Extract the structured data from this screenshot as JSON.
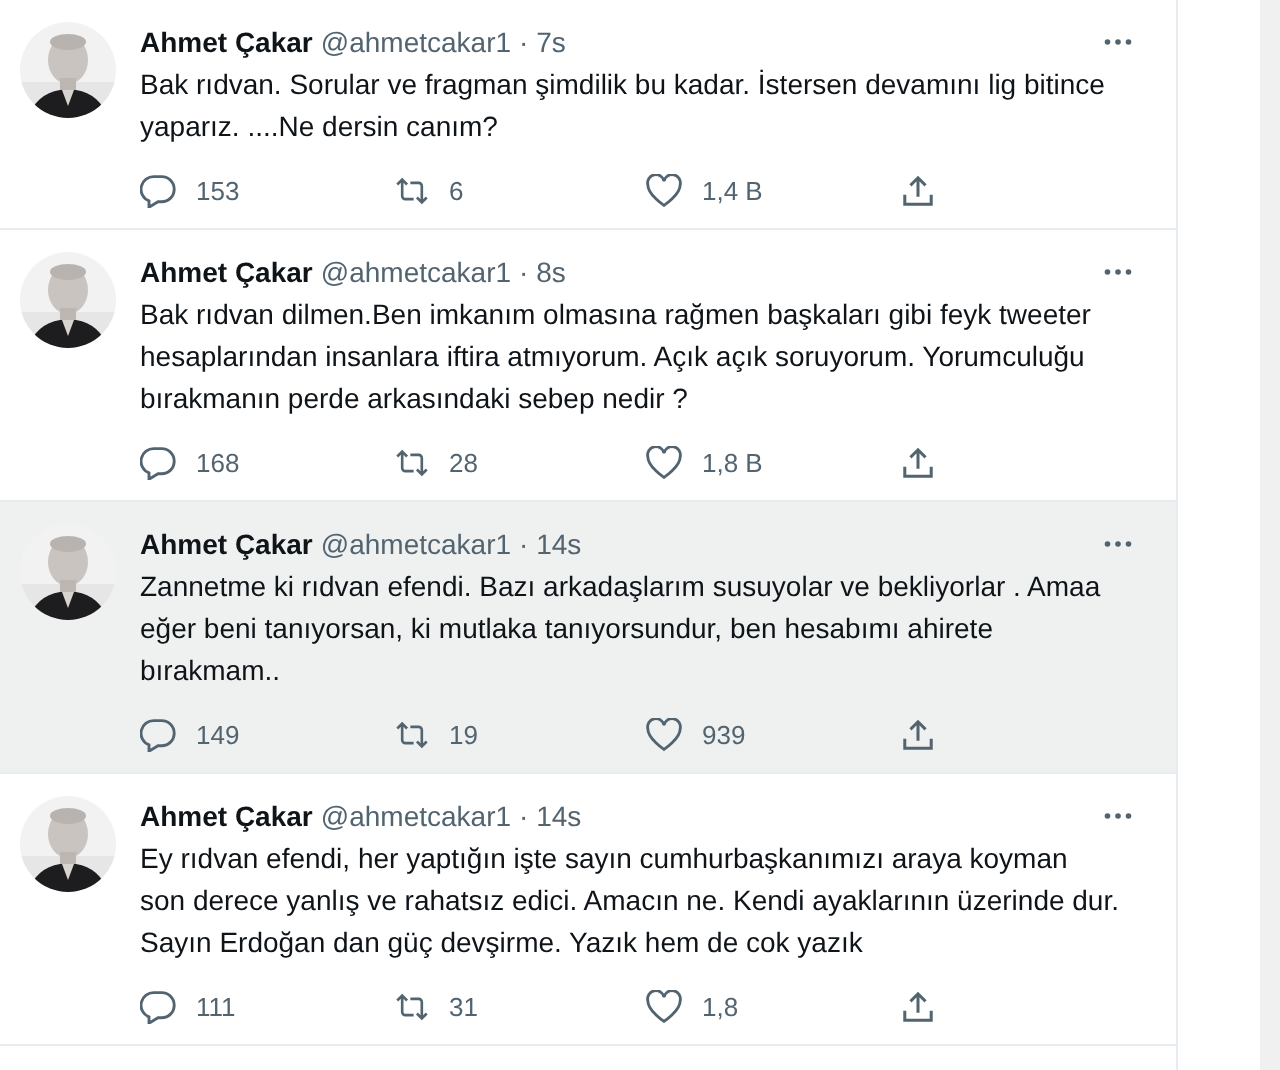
{
  "tweets": [
    {
      "name": "Ahmet Çakar",
      "handle": "@ahmetcakar1",
      "time": "· 7s",
      "text": "Bak rıdvan. Sorular ve fragman şimdilik bu kadar. İstersen devamını lig bitince yaparız. ....Ne dersin canım?",
      "replies": "153",
      "retweets": "6",
      "likes": "1,4 B",
      "highlighted": false
    },
    {
      "name": "Ahmet Çakar",
      "handle": "@ahmetcakar1",
      "time": "· 8s",
      "text": "Bak rıdvan dilmen.Ben imkanım olmasına rağmen başkaları gibi feyk tweeter hesaplarından insanlara iftira atmıyorum. Açık açık soruyorum. Yorumculuğu bırakmanın perde arkasındaki sebep nedir ?",
      "replies": "168",
      "retweets": "28",
      "likes": "1,8 B",
      "highlighted": false
    },
    {
      "name": "Ahmet Çakar",
      "handle": "@ahmetcakar1",
      "time": "· 14s",
      "text": "Zannetme ki rıdvan efendi. Bazı arkadaşlarım susuyolar ve bekliyorlar . Amaa eğer beni tanıyorsan, ki mutlaka tanıyorsundur, ben hesabımı ahirete bırakmam..",
      "replies": "149",
      "retweets": "19",
      "likes": "939",
      "highlighted": true
    },
    {
      "name": "Ahmet Çakar",
      "handle": "@ahmetcakar1",
      "time": "· 14s",
      "text": "Ey rıdvan efendi, her yaptığın işte sayın cumhurbaşkanımızı araya koyman son derece yanlış ve rahatsız edici. Amacın ne. Kendi ayaklarının üzerinde dur. Sayın Erdoğan dan güç devşirme. Yazık hem de cok yazık",
      "replies": "111",
      "retweets": "31",
      "likes": "1,8",
      "highlighted": false
    }
  ]
}
